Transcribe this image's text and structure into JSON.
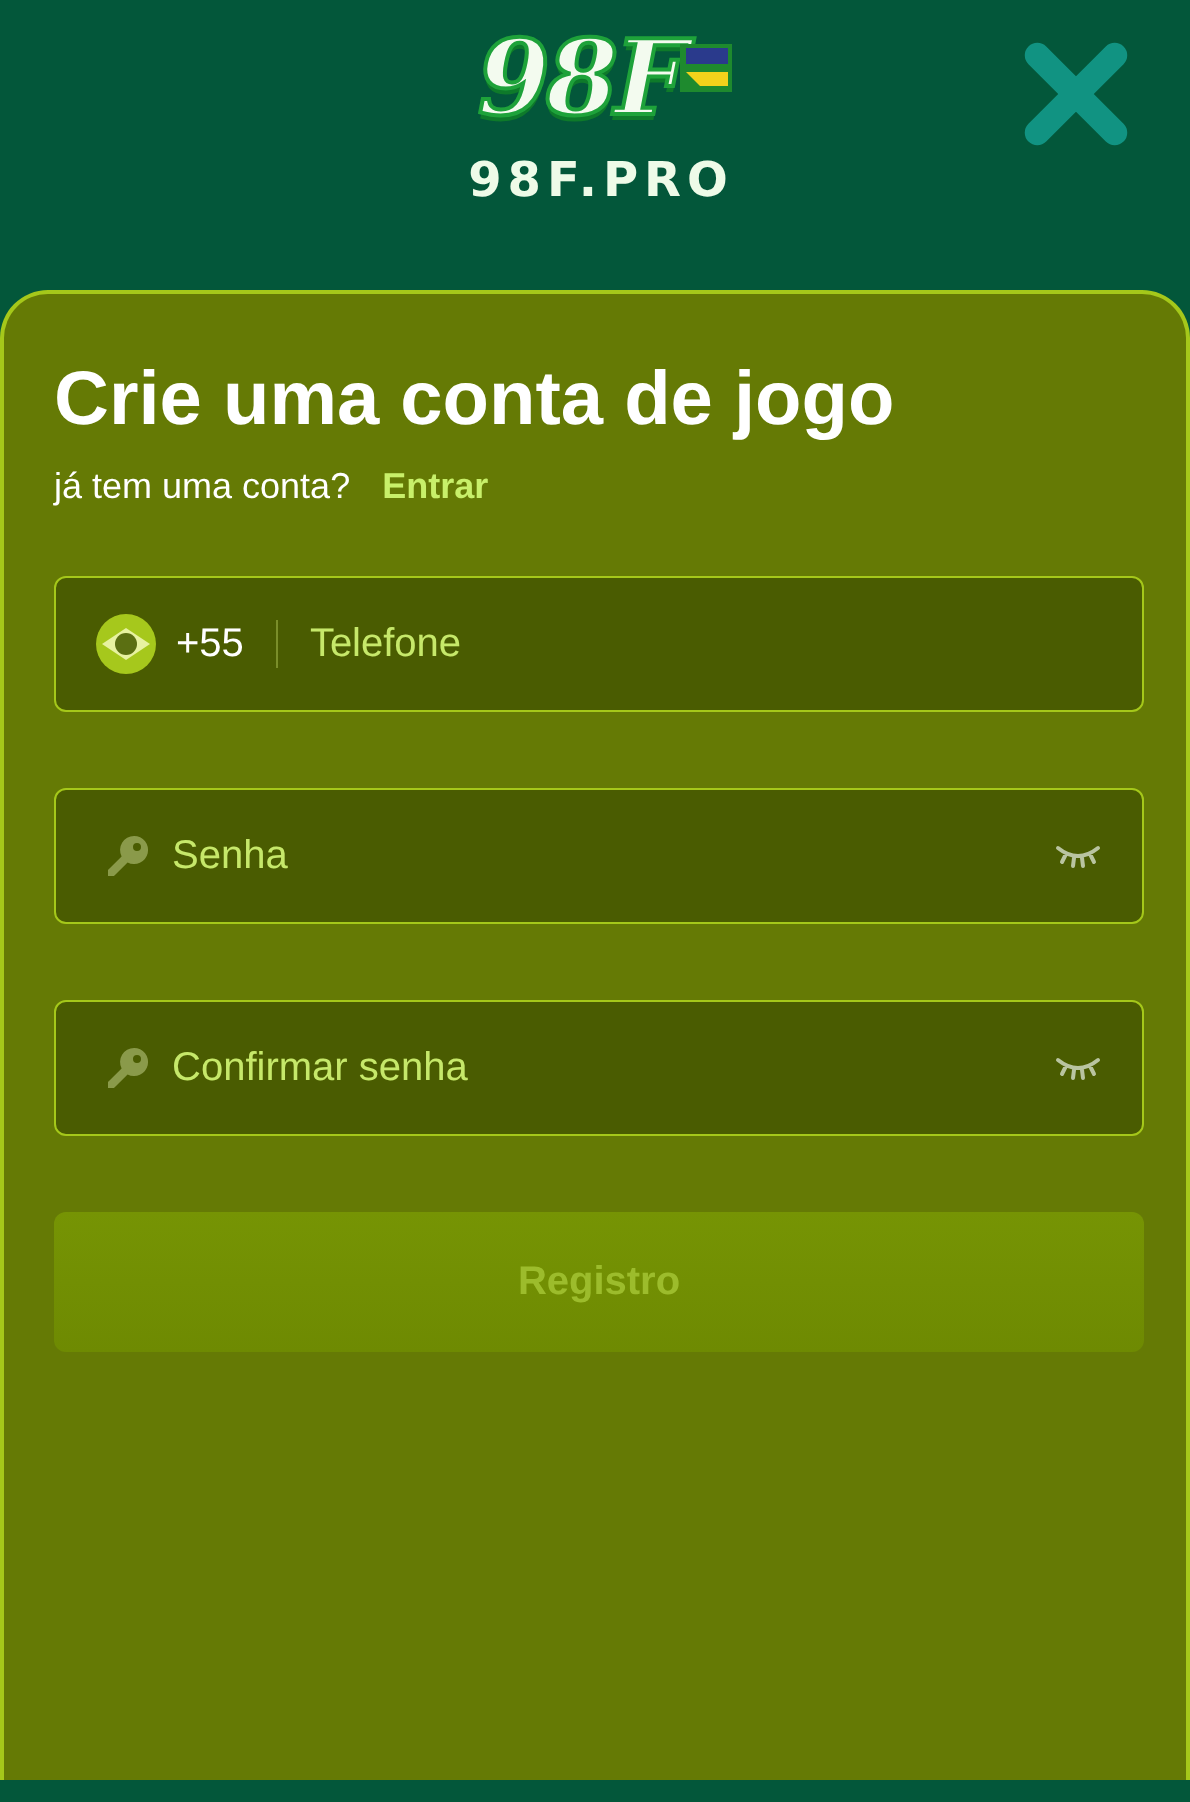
{
  "header": {
    "logo_mark": "98F",
    "logo_text": "98F.PRO"
  },
  "form": {
    "title": "Crie uma conta de jogo",
    "login_prompt": "já tem uma conta?",
    "login_link": "Entrar",
    "fields": [
      {
        "kind": "phone",
        "country_code": "+55",
        "placeholder": "Telefone"
      },
      {
        "kind": "password",
        "placeholder": "Senha"
      },
      {
        "kind": "password",
        "placeholder": "Confirmar senha"
      }
    ],
    "submit": {
      "label": "Registro",
      "disabled": true
    }
  }
}
